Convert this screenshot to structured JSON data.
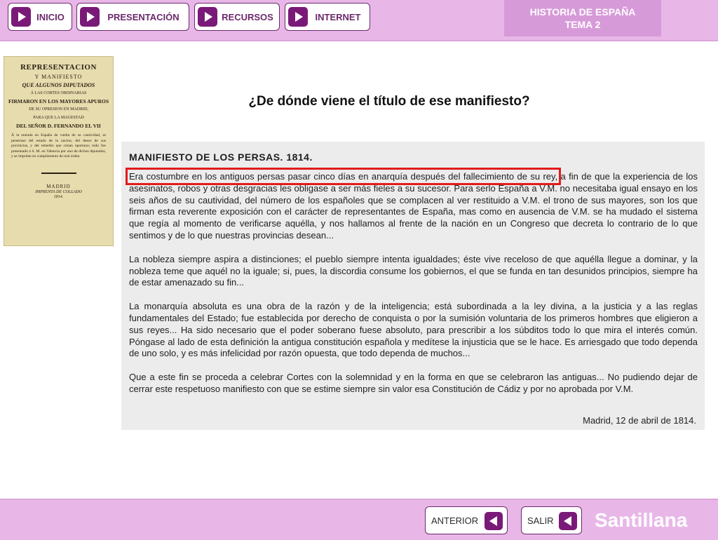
{
  "nav": {
    "buttons": [
      {
        "label": "INICIO"
      },
      {
        "label": "PRESENTACIÓN"
      },
      {
        "label": "RECURSOS"
      },
      {
        "label": "INTERNET"
      }
    ]
  },
  "header": {
    "title_line1": "HISTORIA DE ESPAÑA",
    "title_line2": "TEMA 2"
  },
  "cover_image": {
    "line1": "REPRESENTACION",
    "line2": "Y MANIFIESTO",
    "line3": "QUE ALGUNOS DIPUTADOS",
    "line4": "Á LAS CORTES ORDINARIAS",
    "line5": "FIRMARON EN LOS MAYORES APUROS",
    "line6": "DE SU OPRESION EN MADRID,",
    "line7": "PARA QUE LA MAGESTAD",
    "line8": "DEL SEÑOR D. FERNANDO EL VII",
    "line9": "Á la entrada en España de vuelta de su cautividad, se penetrase del estado de la nacion, del deseo de sus provincias, y del remedio que creian oportuno; todo fue presentado á S. M. en Valencia por uno de dichos diputados, y se imprime en cumplimiento de real órden.",
    "line10": "MADRID",
    "line11": "IMPRENTA DE COLLADO",
    "line12": "1814."
  },
  "main": {
    "question": "¿De dónde viene el título de ese manifiesto?"
  },
  "document": {
    "title": "MANIFIESTO DE LOS PERSAS. 1814.",
    "p1_highlight": "Era costumbre en los antiguos persas pasar cinco días en anarquía después del fallecimiento de su rey,",
    "p1_rest": " a fin de que la experiencia de los asesinatos, robos y otras desgracias les obligase a ser más fieles a su sucesor. Para serlo España a V.M. no necesitaba igual ensayo en los seis años de su cautividad, del número de los españoles que se complacen al ver restituido a V.M. el trono de sus mayores, son los que firman esta reverente exposición con el carácter de representantes de España, mas como en ausencia de V.M. se ha mudado el sistema que regía al momento de verificarse aquélla, y nos hallamos al frente de la nación en un Congreso que decreta lo contrario de lo que sentimos y de lo que nuestras provincias desean...",
    "p2": "La nobleza siempre aspira a distinciones; el pueblo siempre intenta igualdades; éste vive receloso de que aquélla llegue a dominar, y la nobleza teme que aquél no la iguale; si, pues, la discordia consume los gobiernos, el que se funda en tan desunidos principios, siempre ha de estar amenazado su fin...",
    "p3": "La monarquía absoluta es una obra de la razón y de la inteligencia; está subordinada a la ley divina, a la justicia y a las reglas fundamentales del Estado; fue establecida por derecho de conquista o por la sumisión voluntaria de los primeros hombres que eligieron a sus reyes... Ha sido necesario que el poder soberano fuese absoluto, para prescribir a los súbditos todo lo que mira el interés común. Póngase al lado de esta definición la antigua constitución española y medítese la injusticia que se le hace. Es arriesgado que todo dependa de uno solo, y es más infelicidad por razón opuesta, que todo dependa de muchos...",
    "p4": "Que a este fin se proceda a celebrar Cortes con la solemnidad y en la forma en que se celebraron las antiguas... No pudiendo dejar de cerrar este respetuoso manifiesto con que se estime siempre sin valor esa Constitución de Cádiz y por no aprobada por V.M.",
    "signature": "Madrid, 12 de abril de 1814."
  },
  "footer": {
    "prev_label": "ANTERIOR",
    "exit_label": "SALIR",
    "brand": "Santillana"
  },
  "colors": {
    "bar": "#e8b7e8",
    "title_box": "#d79ad9",
    "arrow": "#7a1a78",
    "highlight": "#e21b1b"
  }
}
